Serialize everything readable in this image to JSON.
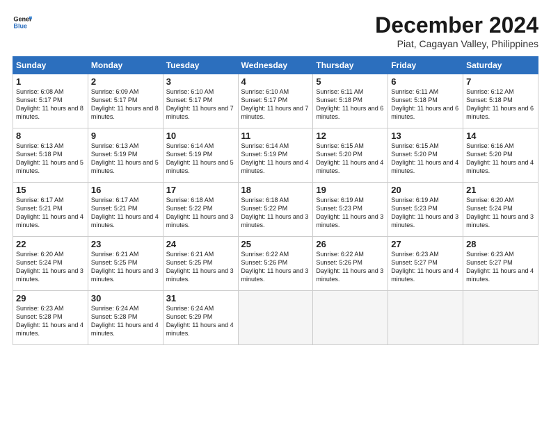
{
  "logo": {
    "line1": "General",
    "line2": "Blue"
  },
  "title": "December 2024",
  "location": "Piat, Cagayan Valley, Philippines",
  "weekdays": [
    "Sunday",
    "Monday",
    "Tuesday",
    "Wednesday",
    "Thursday",
    "Friday",
    "Saturday"
  ],
  "weeks": [
    [
      {
        "day": "1",
        "sunrise": "6:08 AM",
        "sunset": "5:17 PM",
        "daylight": "11 hours and 8 minutes."
      },
      {
        "day": "2",
        "sunrise": "6:09 AM",
        "sunset": "5:17 PM",
        "daylight": "11 hours and 8 minutes."
      },
      {
        "day": "3",
        "sunrise": "6:10 AM",
        "sunset": "5:17 PM",
        "daylight": "11 hours and 7 minutes."
      },
      {
        "day": "4",
        "sunrise": "6:10 AM",
        "sunset": "5:17 PM",
        "daylight": "11 hours and 7 minutes."
      },
      {
        "day": "5",
        "sunrise": "6:11 AM",
        "sunset": "5:18 PM",
        "daylight": "11 hours and 6 minutes."
      },
      {
        "day": "6",
        "sunrise": "6:11 AM",
        "sunset": "5:18 PM",
        "daylight": "11 hours and 6 minutes."
      },
      {
        "day": "7",
        "sunrise": "6:12 AM",
        "sunset": "5:18 PM",
        "daylight": "11 hours and 6 minutes."
      }
    ],
    [
      {
        "day": "8",
        "sunrise": "6:13 AM",
        "sunset": "5:18 PM",
        "daylight": "11 hours and 5 minutes."
      },
      {
        "day": "9",
        "sunrise": "6:13 AM",
        "sunset": "5:19 PM",
        "daylight": "11 hours and 5 minutes."
      },
      {
        "day": "10",
        "sunrise": "6:14 AM",
        "sunset": "5:19 PM",
        "daylight": "11 hours and 5 minutes."
      },
      {
        "day": "11",
        "sunrise": "6:14 AM",
        "sunset": "5:19 PM",
        "daylight": "11 hours and 4 minutes."
      },
      {
        "day": "12",
        "sunrise": "6:15 AM",
        "sunset": "5:20 PM",
        "daylight": "11 hours and 4 minutes."
      },
      {
        "day": "13",
        "sunrise": "6:15 AM",
        "sunset": "5:20 PM",
        "daylight": "11 hours and 4 minutes."
      },
      {
        "day": "14",
        "sunrise": "6:16 AM",
        "sunset": "5:20 PM",
        "daylight": "11 hours and 4 minutes."
      }
    ],
    [
      {
        "day": "15",
        "sunrise": "6:17 AM",
        "sunset": "5:21 PM",
        "daylight": "11 hours and 4 minutes."
      },
      {
        "day": "16",
        "sunrise": "6:17 AM",
        "sunset": "5:21 PM",
        "daylight": "11 hours and 4 minutes."
      },
      {
        "day": "17",
        "sunrise": "6:18 AM",
        "sunset": "5:22 PM",
        "daylight": "11 hours and 3 minutes."
      },
      {
        "day": "18",
        "sunrise": "6:18 AM",
        "sunset": "5:22 PM",
        "daylight": "11 hours and 3 minutes."
      },
      {
        "day": "19",
        "sunrise": "6:19 AM",
        "sunset": "5:23 PM",
        "daylight": "11 hours and 3 minutes."
      },
      {
        "day": "20",
        "sunrise": "6:19 AM",
        "sunset": "5:23 PM",
        "daylight": "11 hours and 3 minutes."
      },
      {
        "day": "21",
        "sunrise": "6:20 AM",
        "sunset": "5:24 PM",
        "daylight": "11 hours and 3 minutes."
      }
    ],
    [
      {
        "day": "22",
        "sunrise": "6:20 AM",
        "sunset": "5:24 PM",
        "daylight": "11 hours and 3 minutes."
      },
      {
        "day": "23",
        "sunrise": "6:21 AM",
        "sunset": "5:25 PM",
        "daylight": "11 hours and 3 minutes."
      },
      {
        "day": "24",
        "sunrise": "6:21 AM",
        "sunset": "5:25 PM",
        "daylight": "11 hours and 3 minutes."
      },
      {
        "day": "25",
        "sunrise": "6:22 AM",
        "sunset": "5:26 PM",
        "daylight": "11 hours and 3 minutes."
      },
      {
        "day": "26",
        "sunrise": "6:22 AM",
        "sunset": "5:26 PM",
        "daylight": "11 hours and 3 minutes."
      },
      {
        "day": "27",
        "sunrise": "6:23 AM",
        "sunset": "5:27 PM",
        "daylight": "11 hours and 4 minutes."
      },
      {
        "day": "28",
        "sunrise": "6:23 AM",
        "sunset": "5:27 PM",
        "daylight": "11 hours and 4 minutes."
      }
    ],
    [
      {
        "day": "29",
        "sunrise": "6:23 AM",
        "sunset": "5:28 PM",
        "daylight": "11 hours and 4 minutes."
      },
      {
        "day": "30",
        "sunrise": "6:24 AM",
        "sunset": "5:28 PM",
        "daylight": "11 hours and 4 minutes."
      },
      {
        "day": "31",
        "sunrise": "6:24 AM",
        "sunset": "5:29 PM",
        "daylight": "11 hours and 4 minutes."
      },
      null,
      null,
      null,
      null
    ]
  ]
}
